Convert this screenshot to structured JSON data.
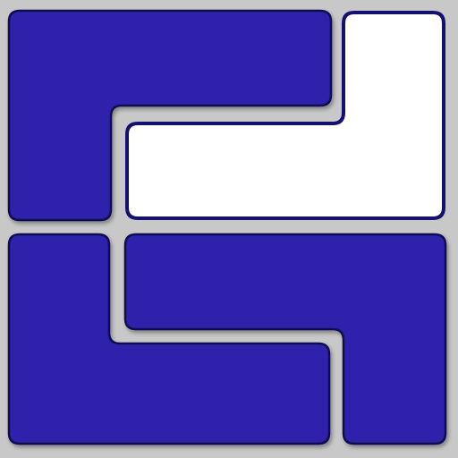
{
  "icon": "interlocking-blocks-logo",
  "colors": {
    "background": "#c8c8c8",
    "block_fill": "#2e24ad",
    "block_outline": "#0e0a50",
    "empty_fill": "#ffffff",
    "empty_outline": "#141070"
  }
}
